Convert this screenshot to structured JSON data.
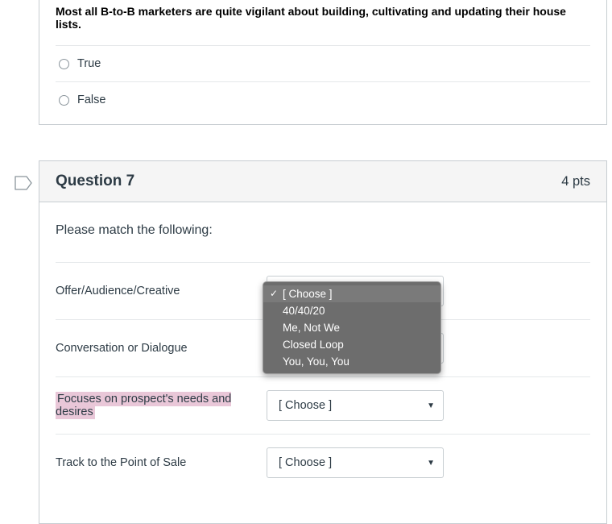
{
  "q6": {
    "stem": "Most all B-to-B marketers are quite vigilant about building, cultivating and updating their house lists.",
    "choice_true": "True",
    "choice_false": "False"
  },
  "q7": {
    "title": "Question 7",
    "points": "4 pts",
    "prompt": "Please match the following:",
    "rows": {
      "r1": "Offer/Audience/Creative",
      "r2": "Conversation or Dialogue",
      "r3": "Focuses on prospect's needs and desires",
      "r4": "Track to the Point of Sale"
    },
    "select_placeholder": "[ Choose ]",
    "dropdown": {
      "opt0": "[ Choose ]",
      "opt1": "40/40/20",
      "opt2": "Me, Not We",
      "opt3": "Closed Loop",
      "opt4": "You, You, You"
    }
  }
}
